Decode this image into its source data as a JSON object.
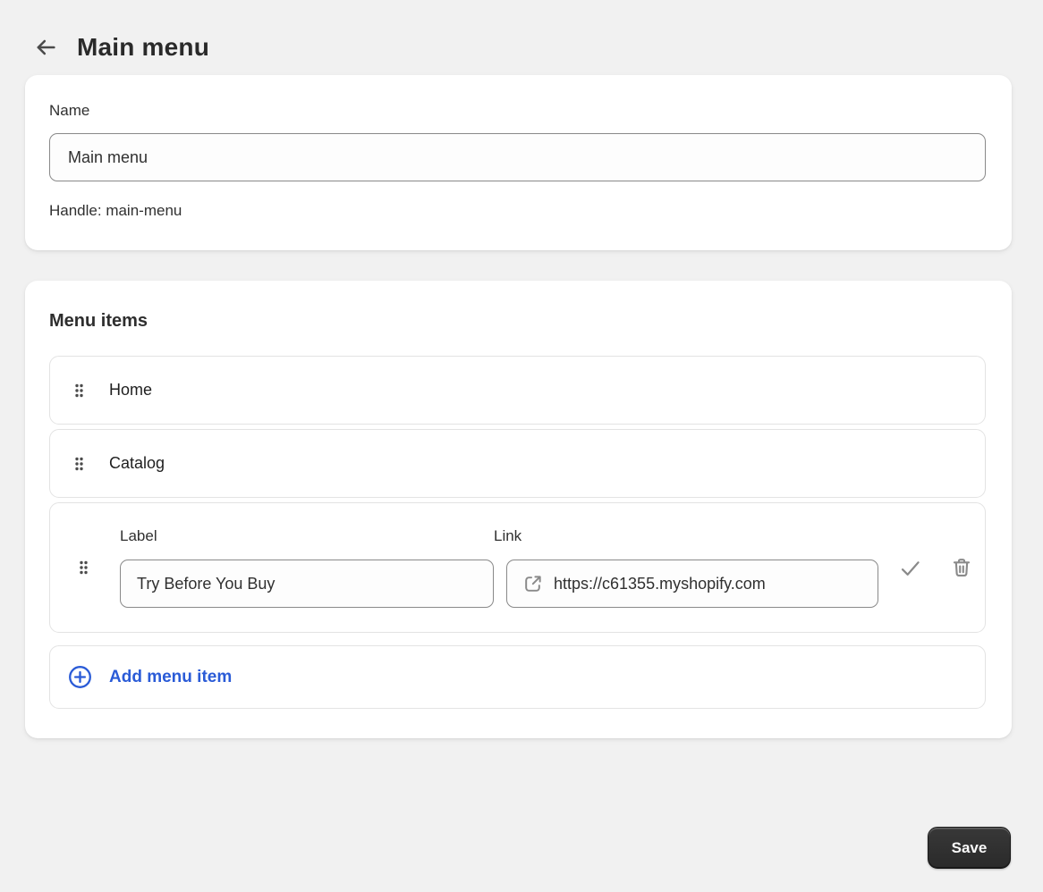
{
  "header": {
    "title": "Main menu",
    "back_icon": "arrow-left"
  },
  "name_card": {
    "name_label": "Name",
    "name_value": "Main menu",
    "handle_text": "Handle: main-menu"
  },
  "menu_items_card": {
    "heading": "Menu items",
    "items": [
      {
        "label": "Home"
      },
      {
        "label": "Catalog"
      }
    ],
    "editing_item": {
      "label_field": {
        "label": "Label",
        "value": "Try Before You Buy"
      },
      "link_field": {
        "label": "Link",
        "value": "https://c61355.myshopify.com",
        "icon": "external-link"
      },
      "confirm_icon": "check",
      "delete_icon": "trash"
    },
    "add_item_label": "Add menu item"
  },
  "footer": {
    "save_label": "Save"
  },
  "colors": {
    "page_bg": "#f1f1f1",
    "card_bg": "#ffffff",
    "text": "#303030",
    "input_border": "#898989",
    "row_border": "#e3e3e3",
    "icon_gray": "#8a8a8a",
    "accent_blue": "#2a5bd7",
    "save_bg": "#2e2e2e"
  }
}
